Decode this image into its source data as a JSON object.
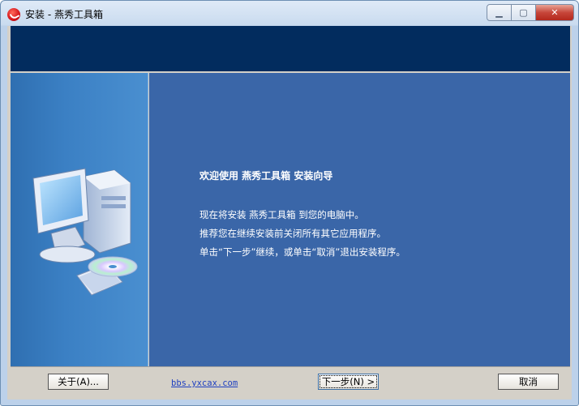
{
  "window": {
    "title": "安装 - 燕秀工具箱",
    "minimize_glyph": "▁",
    "maximize_glyph": "▢",
    "close_glyph": "✕"
  },
  "wizard": {
    "welcome": "欢迎使用 燕秀工具箱 安装向导",
    "line1": "现在将安装 燕秀工具箱       到您的电脑中。",
    "line2": "推荐您在继续安装前关闭所有其它应用程序。",
    "line3": "单击“下一步”继续，或单击“取消”退出安装程序。"
  },
  "footer": {
    "about_label": "关于(A)...",
    "link_text": "bbs.yxcax.com",
    "next_label": "下一步(N) >",
    "cancel_label": "取消"
  },
  "colors": {
    "banner": "#022c5e",
    "main_panel": "#3a66a8",
    "link": "#1e3fc0"
  },
  "icons": [
    "app-logo-icon",
    "computer-cd-illustration"
  ]
}
